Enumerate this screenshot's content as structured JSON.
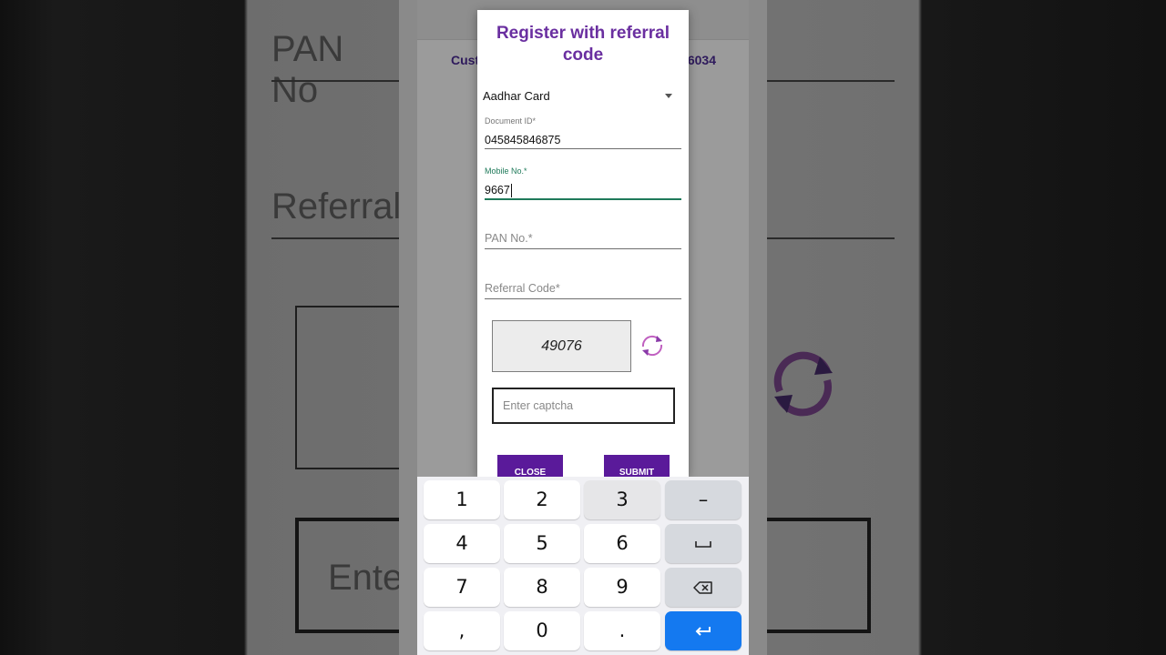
{
  "background": {
    "left_text_1": "PAN No",
    "left_text_2": "Referral",
    "left_text_3": "Ente"
  },
  "underlying_app": {
    "customer_label": "Cust",
    "customer_number": "6034"
  },
  "dialog": {
    "title": "Register with referral code",
    "document_type": {
      "selected": "Aadhar Card"
    },
    "document_id": {
      "label": "Document ID*",
      "value": "045845846875"
    },
    "mobile": {
      "label": "Mobile No.*",
      "value": "9667"
    },
    "pan": {
      "placeholder": "PAN No.*"
    },
    "referral": {
      "placeholder": "Referral Code*"
    },
    "captcha": {
      "code": "49076",
      "input_placeholder": "Enter captcha"
    },
    "buttons": {
      "close": "CLOSE",
      "submit": "SUBMIT"
    }
  },
  "keyboard": {
    "rows": [
      [
        "1",
        "2",
        "3",
        "–"
      ],
      [
        "4",
        "5",
        "6",
        "space"
      ],
      [
        "7",
        "8",
        "9",
        "backspace"
      ],
      [
        ",",
        "0",
        ".",
        "enter"
      ]
    ],
    "labels": {
      "k1": "1",
      "k2": "2",
      "k3": "3",
      "minus": "–",
      "k4": "4",
      "k5": "5",
      "k6": "6",
      "k7": "7",
      "k8": "8",
      "k9": "9",
      "comma": ",",
      "k0": "0",
      "period": "."
    },
    "accent_color": "#1479f0"
  },
  "colors": {
    "title": "#6a2fa0",
    "button": "#5a1a9a",
    "focus": "#1f7a5a"
  }
}
